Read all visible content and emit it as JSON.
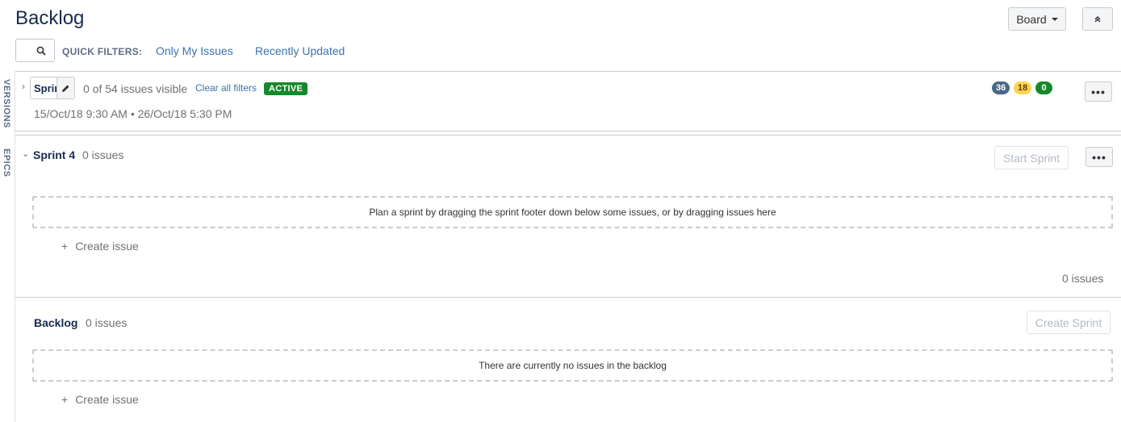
{
  "page": {
    "title": "Backlog"
  },
  "header": {
    "board_label": "Board",
    "collapse_icon": "double-chevron-up-icon"
  },
  "quick_filters": {
    "label": "QUICK FILTERS:",
    "items": [
      "Only My Issues",
      "Recently Updated"
    ]
  },
  "side_tabs": [
    "VERSIONS",
    "EPICS"
  ],
  "active_sprint": {
    "name": "Sprint",
    "visible_text": "0 of 54 issues visible",
    "clear_filters": "Clear all filters",
    "status": "ACTIVE",
    "dates": "15/Oct/18 9:30 AM  •  26/Oct/18 5:30 PM",
    "counts": {
      "todo": "36",
      "in_progress": "18",
      "done": "0"
    },
    "colors": {
      "todo": "#4a6785",
      "in_progress": "#ffd351",
      "done": "#14892c",
      "active": "#14892c"
    }
  },
  "sprint4": {
    "name": "Sprint 4",
    "count": "0 issues",
    "start_label": "Start Sprint",
    "drop_text": "Plan a sprint by dragging the sprint footer down below some issues, or by dragging issues here",
    "create_issue": "Create issue",
    "footer_count": "0 issues"
  },
  "backlog": {
    "name": "Backlog",
    "count": "0 issues",
    "create_sprint_label": "Create Sprint",
    "empty_text": "There are currently no issues in the backlog",
    "create_issue": "Create issue"
  },
  "more_label": "•••"
}
